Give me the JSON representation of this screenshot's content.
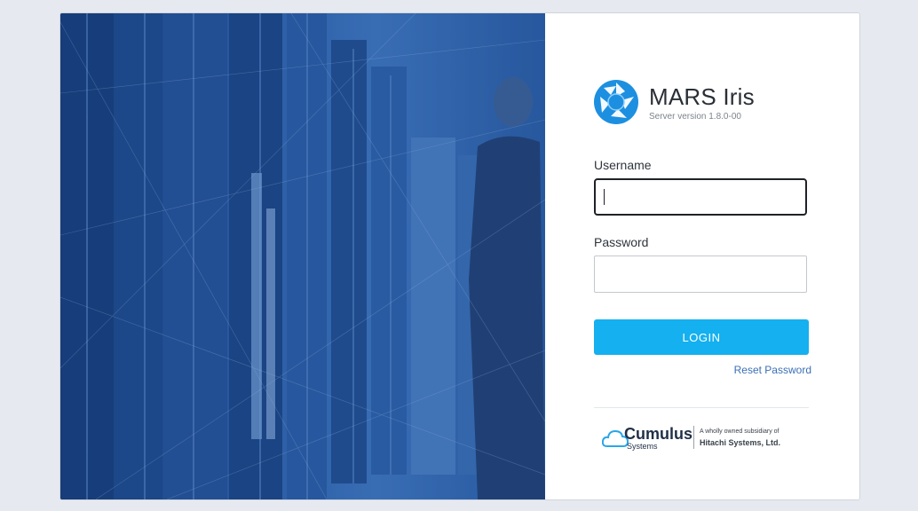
{
  "brand": {
    "app_name": "MARS Iris",
    "server_version": "Server version 1.8.0-00"
  },
  "form": {
    "username_label": "Username",
    "username_value": "",
    "password_label": "Password",
    "password_value": "",
    "login_label": "LOGIN",
    "reset_label": "Reset Password"
  },
  "footer": {
    "company": "Cumulus",
    "company_sub": "Systems",
    "subsidiary_line1": "A wholly owned subsidiary of",
    "subsidiary_line2": "Hitachi Systems, Ltd."
  },
  "colors": {
    "accent": "#14b0ef",
    "link": "#3b6fb6",
    "hero_blue": "#2a5ba3"
  },
  "icons": {
    "logo": "aperture-logo-icon",
    "footer_logo": "cloud-logo-icon"
  }
}
